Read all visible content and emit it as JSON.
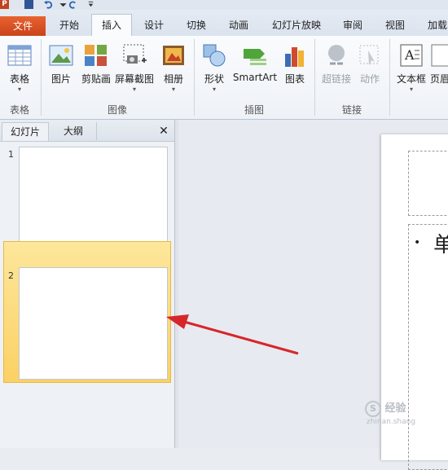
{
  "ribbon_tabs": [
    "文件",
    "开始",
    "插入",
    "设计",
    "切换",
    "动画",
    "幻灯片放映",
    "审阅",
    "视图",
    "加载"
  ],
  "active_tab": "插入",
  "buttons": {
    "table": "表格",
    "picture": "图片",
    "clipart": "剪贴画",
    "screenshot": "屏幕截图",
    "album": "相册",
    "shapes": "形状",
    "smartart": "SmartArt",
    "chart": "图表",
    "hyperlink": "超链接",
    "action": "动作",
    "textbox": "文本框",
    "header": "页眉"
  },
  "groups": {
    "tables": "表格",
    "images": "图像",
    "illustrations": "插图",
    "links": "链接"
  },
  "pane": {
    "tab_slides": "幻灯片",
    "tab_outline": "大纲",
    "close_glyph": "✕",
    "slide_numbers": [
      "1",
      "2"
    ],
    "selected_slide": 2
  },
  "slide_body_text": "单",
  "watermark": {
    "line1": "经验",
    "line2": "zhinan.shang"
  },
  "colors": {
    "file_tab": "#d2491e",
    "selection": "#fbd164",
    "arrow": "#d7262a"
  }
}
